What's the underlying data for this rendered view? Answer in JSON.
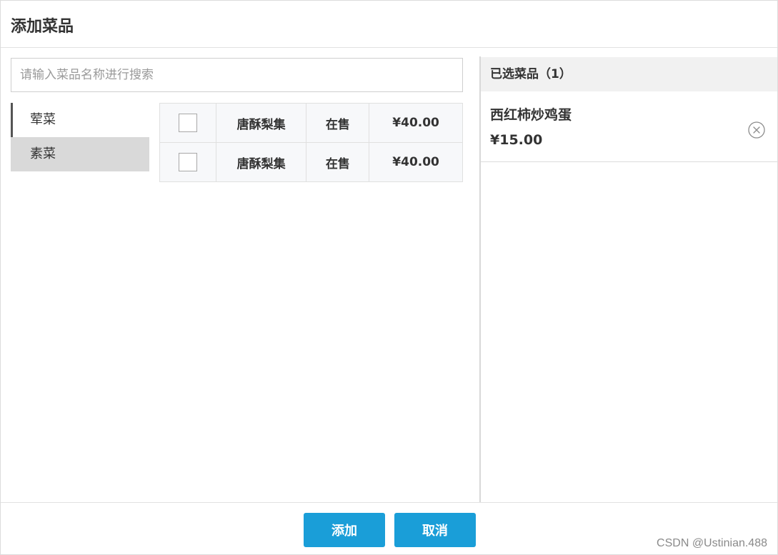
{
  "dialog": {
    "title": "添加菜品"
  },
  "search": {
    "placeholder": "请输入菜品名称进行搜索",
    "value": ""
  },
  "categories": [
    {
      "label": "荤菜",
      "state": "active"
    },
    {
      "label": "素菜",
      "state": "hover"
    }
  ],
  "dishes": [
    {
      "checked": false,
      "name": "唐酥梨集",
      "status": "在售",
      "price": "¥40.00"
    },
    {
      "checked": false,
      "name": "唐酥梨集",
      "status": "在售",
      "price": "¥40.00"
    }
  ],
  "selected": {
    "header": "已选菜品（1）",
    "items": [
      {
        "name": "西红柿炒鸡蛋",
        "price": "¥15.00",
        "remove_icon": "circle-x-icon"
      }
    ]
  },
  "footer": {
    "add_label": "添加",
    "cancel_label": "取消"
  },
  "watermark": "CSDN @Ustinian.488",
  "colors": {
    "primary": "#1a9ed8",
    "hover_bg": "#d9d9d9",
    "header_bg": "#f1f1f1"
  }
}
